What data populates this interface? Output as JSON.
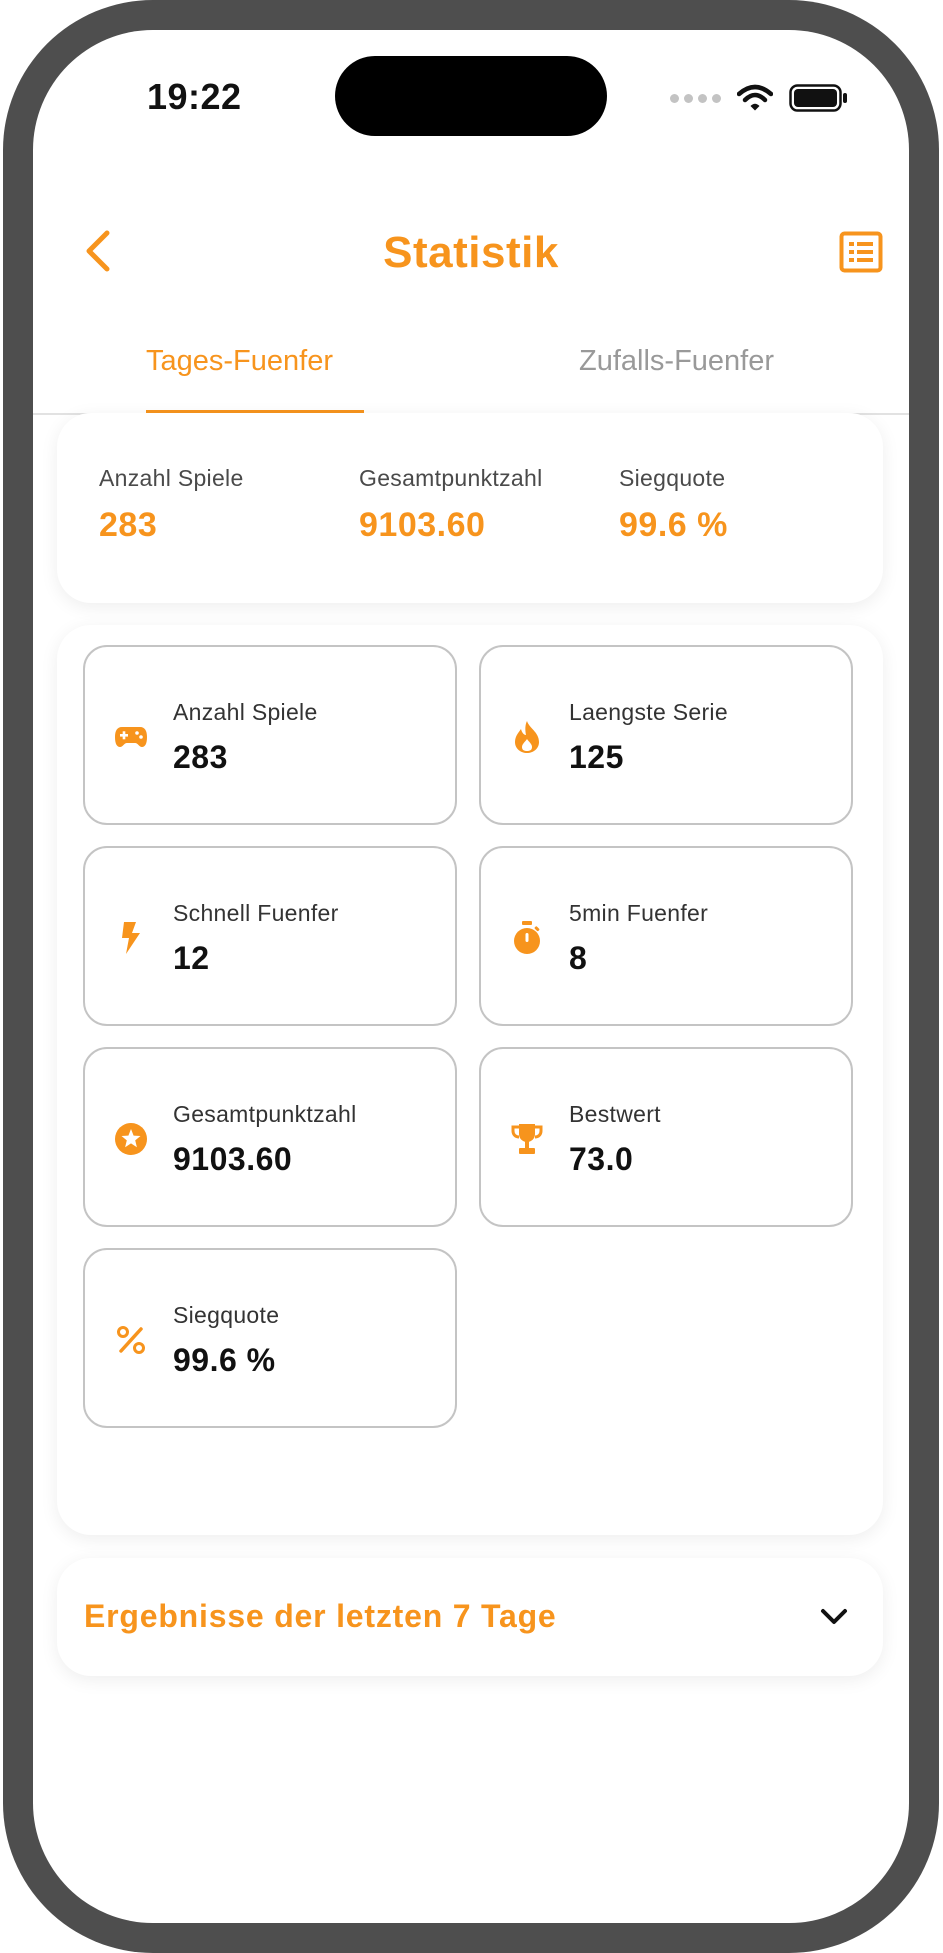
{
  "colors": {
    "accent": "#f7941d",
    "frame": "#4e4e4e",
    "text": "#111111",
    "muted": "#999999",
    "border": "#c4c4c4"
  },
  "status_bar": {
    "time": "19:22"
  },
  "header": {
    "title": "Statistik",
    "back_icon": "chevron-left-icon",
    "action_icon": "list-icon"
  },
  "tabs": [
    {
      "label": "Tages-Fuenfer",
      "active": true
    },
    {
      "label": "Zufalls-Fuenfer",
      "active": false
    }
  ],
  "summary": [
    {
      "label": "Anzahl Spiele",
      "value": "283"
    },
    {
      "label": "Gesamtpunktzahl",
      "value": "9103.60"
    },
    {
      "label": "Siegquote",
      "value": "99.6 %"
    }
  ],
  "stats": [
    {
      "icon": "gamepad-icon",
      "label": "Anzahl Spiele",
      "value": "283"
    },
    {
      "icon": "flame-icon",
      "label": "Laengste Serie",
      "value": "125"
    },
    {
      "icon": "lightning-icon",
      "label": "Schnell Fuenfer",
      "value": "12"
    },
    {
      "icon": "timer-icon",
      "label": "5min Fuenfer",
      "value": "8"
    },
    {
      "icon": "star-icon",
      "label": "Gesamtpunktzahl",
      "value": "9103.60"
    },
    {
      "icon": "trophy-icon",
      "label": "Bestwert",
      "value": "73.0"
    },
    {
      "icon": "percent-icon",
      "label": "Siegquote",
      "value": "99.6 %"
    }
  ],
  "expander": {
    "title": "Ergebnisse der letzten 7 Tage",
    "icon": "chevron-down-icon"
  }
}
